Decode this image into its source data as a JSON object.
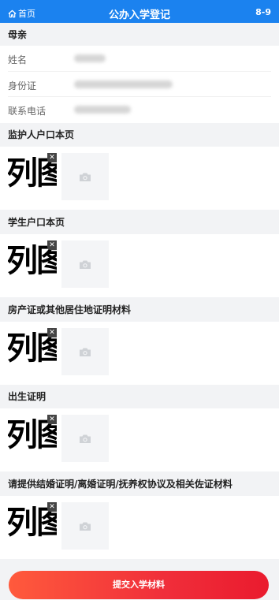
{
  "header": {
    "home_label": "首页",
    "title": "公办入学登记",
    "right_text": "8-9"
  },
  "mother": {
    "section_title": "母亲",
    "fields": [
      {
        "label": "姓名"
      },
      {
        "label": "身份证"
      },
      {
        "label": "联系电话"
      }
    ]
  },
  "uploads": [
    {
      "title": "监护人户口本页",
      "thumb_text": "列图"
    },
    {
      "title": "学生户口本页",
      "thumb_text": "列图"
    },
    {
      "title": "房产证或其他居住地证明材料",
      "thumb_text": "列图"
    },
    {
      "title": "出生证明",
      "thumb_text": "列图"
    },
    {
      "title": "请提供结婚证明/离婚证明/抚养权协议及相关佐证材料",
      "thumb_text": "列图"
    }
  ],
  "submit_label": "提交入学材料",
  "icons": {
    "home": "home-icon",
    "camera": "camera-icon",
    "delete": "close-icon"
  },
  "colors": {
    "header": "#1b82ef",
    "button_start": "#ff5a3c",
    "button_end": "#ea1b2e"
  }
}
